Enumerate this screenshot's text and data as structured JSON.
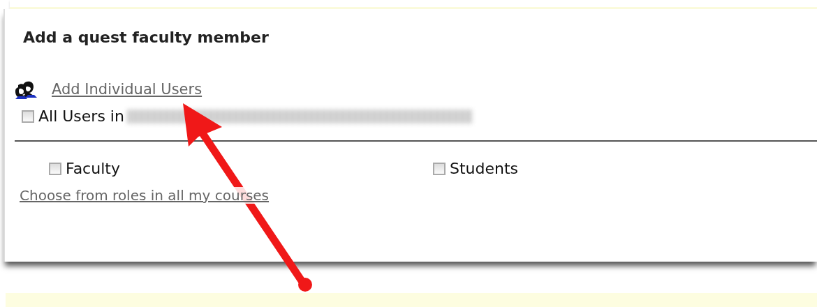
{
  "dialog": {
    "title": "Add a quest faculty member"
  },
  "individual_link": "Add Individual Users",
  "all_users": {
    "label": "All Users in",
    "checked": false
  },
  "roles": [
    {
      "label": "Faculty",
      "checked": false
    },
    {
      "label": "Students",
      "checked": false
    }
  ],
  "roles_link": "Choose from roles in all my courses"
}
